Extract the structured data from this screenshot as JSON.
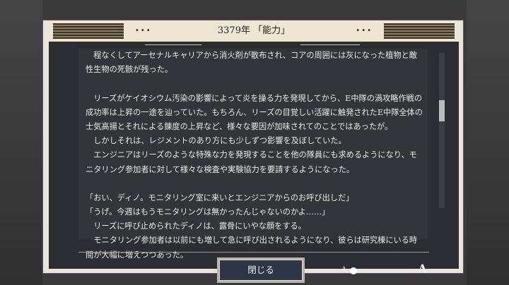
{
  "window": {
    "title": "3379年 「能力」"
  },
  "header": {
    "left_dots": "•••",
    "right_dots": "•••"
  },
  "body_lines": [
    "　程なくしてアーセナルキャリアから消火剤が散布され、コアの周囲には灰になった植物と敵",
    "性生物の死骸が残った。",
    "",
    "　リーズがケイオシウム汚染の影響によって炎を操る力を発現してから、E中隊の渦攻略作戦の",
    "成功率は上昇の一途を辿っていた。もちろん、リーズの目覚しい活躍に触発されたE中隊全体の",
    "士気高揚とそれによる錬度の上昇など、様々な要因が加味されてのことではあったが。",
    "　しかしそれは、レジメントのあり方にも少しずつ影響を及ぼしていた。",
    "　エンジニアはリーズのような特殊な力を発現することを他の隊員にも求めるようになり、モ",
    "ニタリング参加者に対して様々な検査や実験協力を要請するようになった。",
    "",
    "「おい、ディノ。モニタリング室に来いとエンジニアからのお呼び出しだ」",
    "「うげ。今週はもうモニタリングは無かったんじゃないのかよ……」",
    "　リーズに呼び止められたディノは、露骨にいやな顔をする。",
    "　モニタリング参加者は以前にも増して急に呼び出されるようになり、彼らは研究棟にいる時",
    "間が大幅に増えつつあった。"
  ],
  "buttons": {
    "close_label": "閉じる"
  },
  "font_size_control": {
    "small_label": "A",
    "large_label": "A",
    "level": 0.0
  },
  "scroll": {
    "position": 0.35
  }
}
